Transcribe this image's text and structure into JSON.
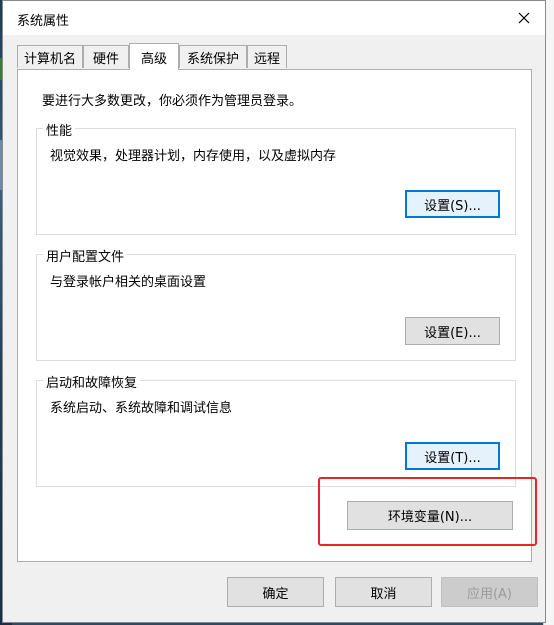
{
  "window": {
    "title": "系统属性"
  },
  "tabs": [
    {
      "label": "计算机名"
    },
    {
      "label": "硬件"
    },
    {
      "label": "高级"
    },
    {
      "label": "系统保护"
    },
    {
      "label": "远程"
    }
  ],
  "active_tab": "高级",
  "intro": "要进行大多数更改，你必须作为管理员登录。",
  "groups": {
    "performance": {
      "title": "性能",
      "desc": "视觉效果，处理器计划，内存使用，以及虚拟内存",
      "button": "设置(S)..."
    },
    "profile": {
      "title": "用户配置文件",
      "desc": "与登录帐户相关的桌面设置",
      "button": "设置(E)..."
    },
    "startup": {
      "title": "启动和故障恢复",
      "desc": "系统启动、系统故障和调试信息",
      "button": "设置(T)..."
    }
  },
  "env_button": "环境变量(N)...",
  "footer": {
    "ok": "确定",
    "cancel": "取消",
    "apply": "应用(A)"
  },
  "colors": {
    "focus_border": "#0078d7",
    "highlight": "#e8262a",
    "panel": "#ffffff",
    "dialog": "#f0f0f0"
  }
}
